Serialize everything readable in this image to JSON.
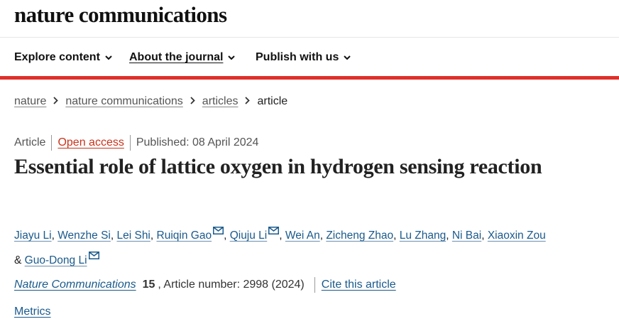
{
  "header": {
    "brand": "nature communications"
  },
  "nav": [
    {
      "label": "Explore content"
    },
    {
      "label": "About the journal"
    },
    {
      "label": "Publish with us"
    }
  ],
  "breadcrumb": [
    "nature",
    "nature communications",
    "articles",
    "article"
  ],
  "meta": {
    "type": "Article",
    "access": "Open access",
    "published": "Published: 08 April 2024"
  },
  "article": {
    "title": "Essential role of lattice oxygen in hydrogen sensing reaction"
  },
  "authors": [
    {
      "name": "Jiayu Li"
    },
    {
      "name": "Wenzhe Si"
    },
    {
      "name": "Lei Shi"
    },
    {
      "name": "Ruiqin Gao",
      "email": true
    },
    {
      "name": "Qiuju Li",
      "email": true
    },
    {
      "name": "Wei An"
    },
    {
      "name": "Zicheng Zhao"
    },
    {
      "name": "Lu Zhang"
    },
    {
      "name": "Ni Bai"
    },
    {
      "name": "Xiaoxin Zou"
    },
    {
      "name": "Guo-Dong Li",
      "email": true
    }
  ],
  "citation": {
    "journal": "Nature Communications",
    "volume": "15",
    "details": ", Article number: 2998 (2024)",
    "cite_label": "Cite this article"
  },
  "metrics_label": "Metrics",
  "colors": {
    "accent_red": "#e0302b",
    "link_blue": "#1a5a8c",
    "open_access": "#c8331b"
  },
  "icons": {
    "nav_chevron": "chevron-down-icon",
    "breadcrumb_sep": "chevron-right-icon",
    "author_email": "envelope-icon"
  }
}
